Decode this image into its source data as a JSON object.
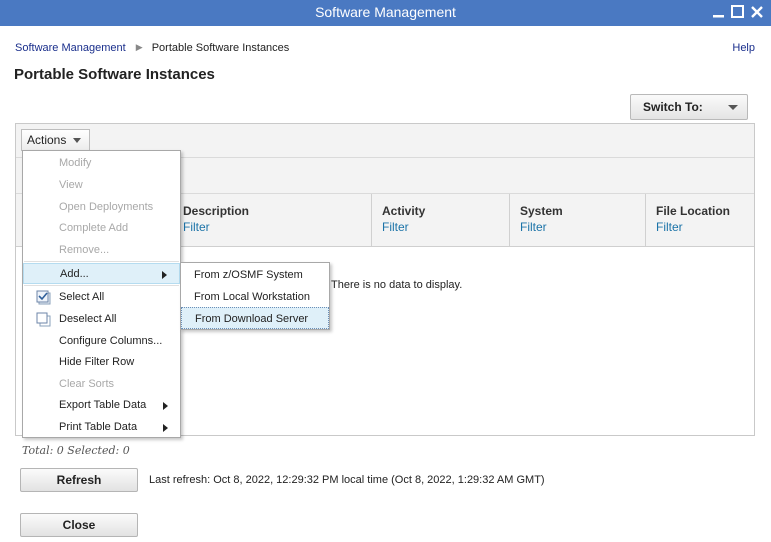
{
  "window": {
    "title": "Software Management"
  },
  "breadcrumb": {
    "root": "Software Management",
    "current": "Portable Software Instances"
  },
  "help": "Help",
  "page_title": "Portable Software Instances",
  "switch_to": {
    "label": "Switch To:"
  },
  "actions": {
    "label": "Actions"
  },
  "columns": [
    {
      "header": "Description",
      "filter": "Filter"
    },
    {
      "header": "Activity",
      "filter": "Filter"
    },
    {
      "header": "System",
      "filter": "Filter"
    },
    {
      "header": "File Location",
      "filter": "Filter"
    }
  ],
  "empty_message": "There is no data to display.",
  "totals": "Total: 0 Selected: 0",
  "refresh": {
    "button": "Refresh",
    "info": "Last refresh: Oct 8, 2022, 12:29:32 PM local time (Oct 8, 2022, 1:29:32 AM GMT)"
  },
  "close_button": "Close",
  "actions_menu": {
    "items": [
      {
        "label": "Modify"
      },
      {
        "label": "View"
      },
      {
        "label": "Open Deployments"
      },
      {
        "label": "Complete Add"
      },
      {
        "label": "Remove..."
      },
      {
        "label": "Add..."
      },
      {
        "label": "Select All"
      },
      {
        "label": "Deselect All"
      },
      {
        "label": "Configure Columns..."
      },
      {
        "label": "Hide Filter Row"
      },
      {
        "label": "Clear Sorts"
      },
      {
        "label": "Export Table Data"
      },
      {
        "label": "Print Table Data"
      }
    ]
  },
  "add_submenu": {
    "items": [
      {
        "label": "From z/OSMF System"
      },
      {
        "label": "From Local Workstation"
      },
      {
        "label": "From Download Server"
      }
    ]
  },
  "colors": {
    "titlebar": "#4a79c2",
    "link": "#1a2f8c",
    "filter": "#1b73a8",
    "menu_highlight": "#dff0f9"
  }
}
